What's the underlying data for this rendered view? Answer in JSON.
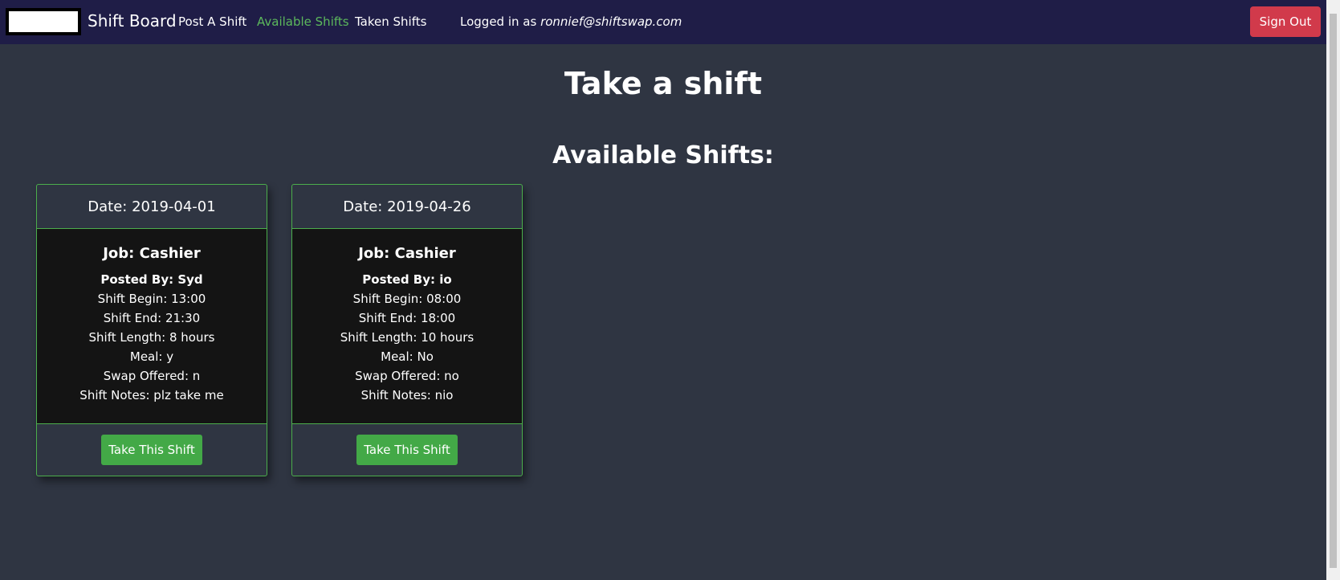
{
  "navbar": {
    "brand": "Shift Board",
    "links": [
      {
        "label": "Post A Shift"
      },
      {
        "label": "Available Shifts"
      },
      {
        "label": "Taken Shifts"
      }
    ],
    "logged_in_prefix": "Logged in as ",
    "user_email": "ronnief@shiftswap.com",
    "sign_out_label": "Sign Out"
  },
  "main": {
    "title": "Take a shift",
    "section_title": "Available Shifts:",
    "shifts": [
      {
        "date": "Date: 2019-04-01",
        "job": "Job: Cashier",
        "posted_by": "Posted By: Syd",
        "shift_begin": "Shift Begin: 13:00",
        "shift_end": "Shift End: 21:30",
        "shift_length": "Shift Length: 8 hours",
        "meal": "Meal: y",
        "swap_offered": "Swap Offered: n",
        "shift_notes": "Shift Notes: plz take me",
        "button_label": "Take This Shift"
      },
      {
        "date": "Date: 2019-04-26",
        "job": "Job: Cashier",
        "posted_by": "Posted By: io",
        "shift_begin": "Shift Begin: 08:00",
        "shift_end": "Shift End: 18:00",
        "shift_length": "Shift Length: 10 hours",
        "meal": "Meal: No",
        "swap_offered": "Swap Offered: no",
        "shift_notes": "Shift Notes: nio",
        "button_label": "Take This Shift"
      }
    ]
  },
  "colors": {
    "navbar_bg": "#1f1d47",
    "page_bg": "#2f3542",
    "card_body_bg": "#141414",
    "accent_green": "#43a947",
    "active_link": "#5cb85c",
    "danger": "#d13a4b"
  }
}
